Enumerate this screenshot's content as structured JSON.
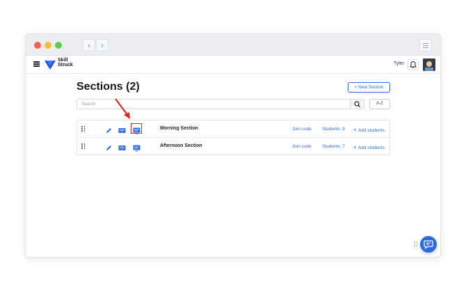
{
  "header": {
    "logo_line1": "Skill",
    "logo_line2": "Struck",
    "user_name": "Tyler"
  },
  "page": {
    "title": "Sections (2)",
    "new_section_label": "New Section",
    "search_placeholder": "Search",
    "sort_label": "A-Z"
  },
  "sections": [
    {
      "name": "Morning Section",
      "join_code_label": "Join code",
      "students_label": "Students: 9",
      "add_students_label": "Add students"
    },
    {
      "name": "Afternoon Section",
      "join_code_label": "Join code",
      "students_label": "Students: 7",
      "add_students_label": "Add students"
    }
  ],
  "colors": {
    "accent": "#2d6ae0",
    "highlight": "#e2241a",
    "text": "#15181d"
  },
  "icons": [
    "hamburger-icon",
    "bell-icon",
    "drag-handle-icon",
    "edit-pencil-icon",
    "book-icon",
    "screen-icon",
    "search-icon",
    "plus-icon",
    "chat-icon"
  ]
}
